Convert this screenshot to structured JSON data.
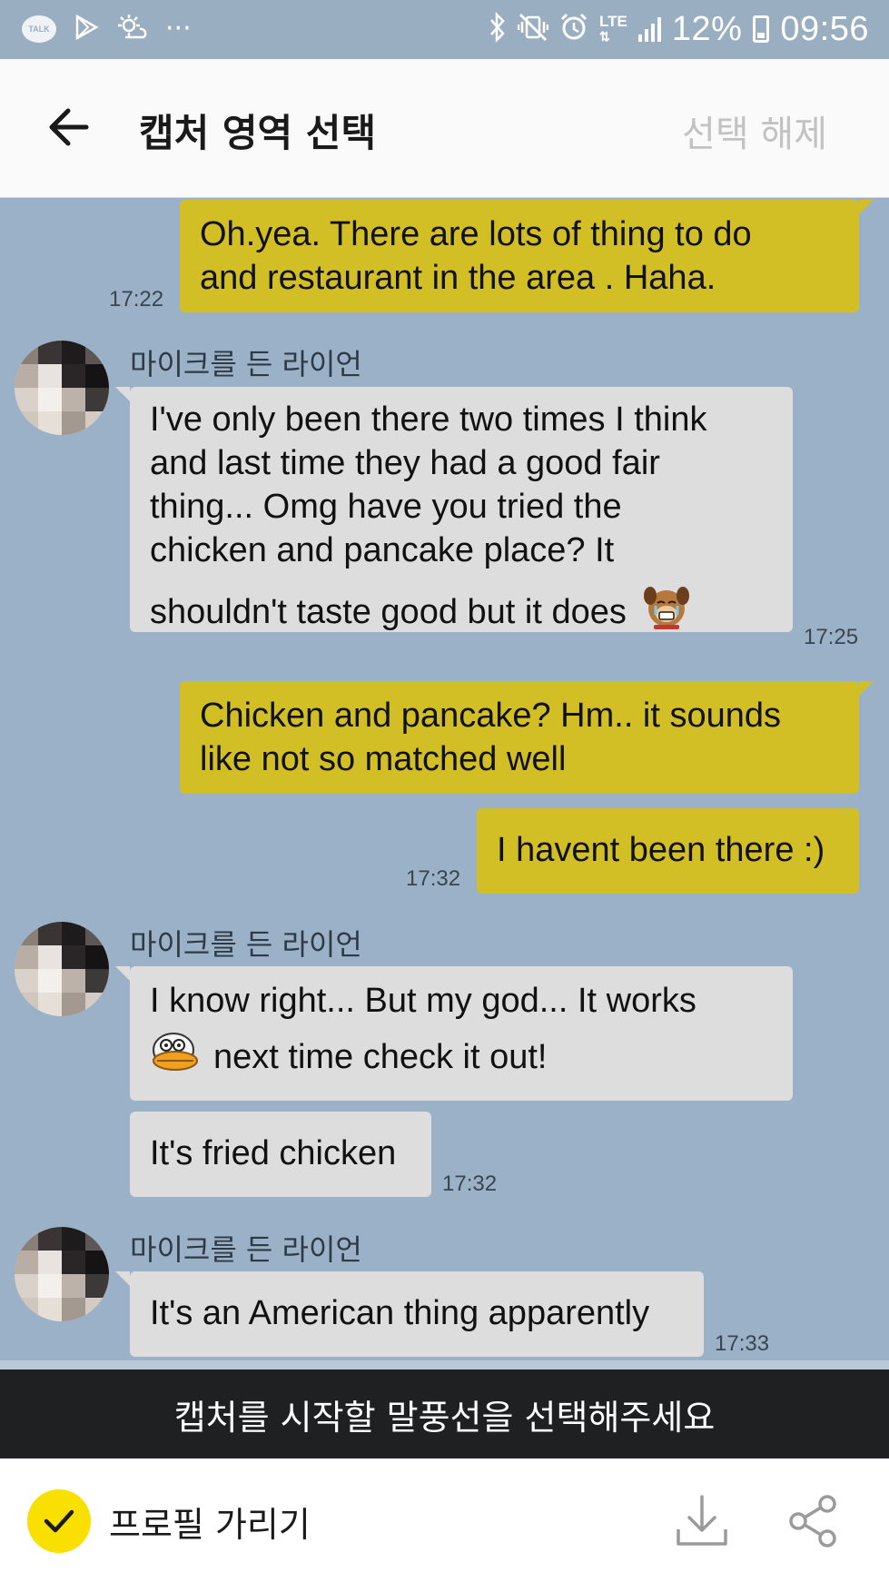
{
  "status_bar": {
    "left_icons": [
      "talk-icon",
      "play-store-icon",
      "weather-icon",
      "more-dots-icon"
    ],
    "talk_badge": "TALK",
    "more_dots": "···",
    "lte": "LTE",
    "battery_percent": "12%",
    "time": "09:56"
  },
  "header": {
    "title": "캡처 영역 선택",
    "deselect_label": "선택 해제"
  },
  "chat": {
    "messages": [
      {
        "from": "me",
        "lines": [
          "Oh.yea. There are lots of thing  to do",
          "and restaurant in the area . Haha."
        ],
        "time": "17:22"
      },
      {
        "from": "other",
        "sender": "마이크를 든 라이언",
        "lines": [
          "I've only been there two times I think",
          "and last time they had a good fair",
          "thing... Omg have you tried the",
          "chicken and pancake place? It",
          "shouldn't taste good but it does"
        ],
        "emoticon": "crying-dog-emoticon",
        "time": "17:25"
      },
      {
        "from": "me",
        "lines": [
          "Chicken and pancake? Hm.. it sounds",
          "like not so matched well"
        ]
      },
      {
        "from": "me",
        "lines": [
          "I havent been there :)"
        ],
        "time": "17:32"
      },
      {
        "from": "other",
        "sender": "마이크를 든 라이언",
        "lines": [
          "I know right... But my god... It works",
          "next time check it out!"
        ],
        "emoticon": "duck-emoticon"
      },
      {
        "from": "other",
        "lines": [
          "It's fried chicken"
        ],
        "time": "17:32"
      },
      {
        "from": "other",
        "sender": "마이크를 든 라이언",
        "lines": [
          "It's an American thing apparently"
        ],
        "time": "17:33"
      }
    ]
  },
  "instruction": "캡처를 시작할 말풍선을 선택해주세요",
  "bottom_bar": {
    "hide_profile_label": "프로필 가리기",
    "hide_profile_checked": true,
    "download_icon": "download-icon",
    "share_icon": "share-icon"
  },
  "colors": {
    "chat_background": "#9bb1c7",
    "my_bubble": "#d2bf26",
    "other_bubble": "#dddddd",
    "instruction_bar": "#1e2022",
    "check_accent": "#f9e000"
  }
}
